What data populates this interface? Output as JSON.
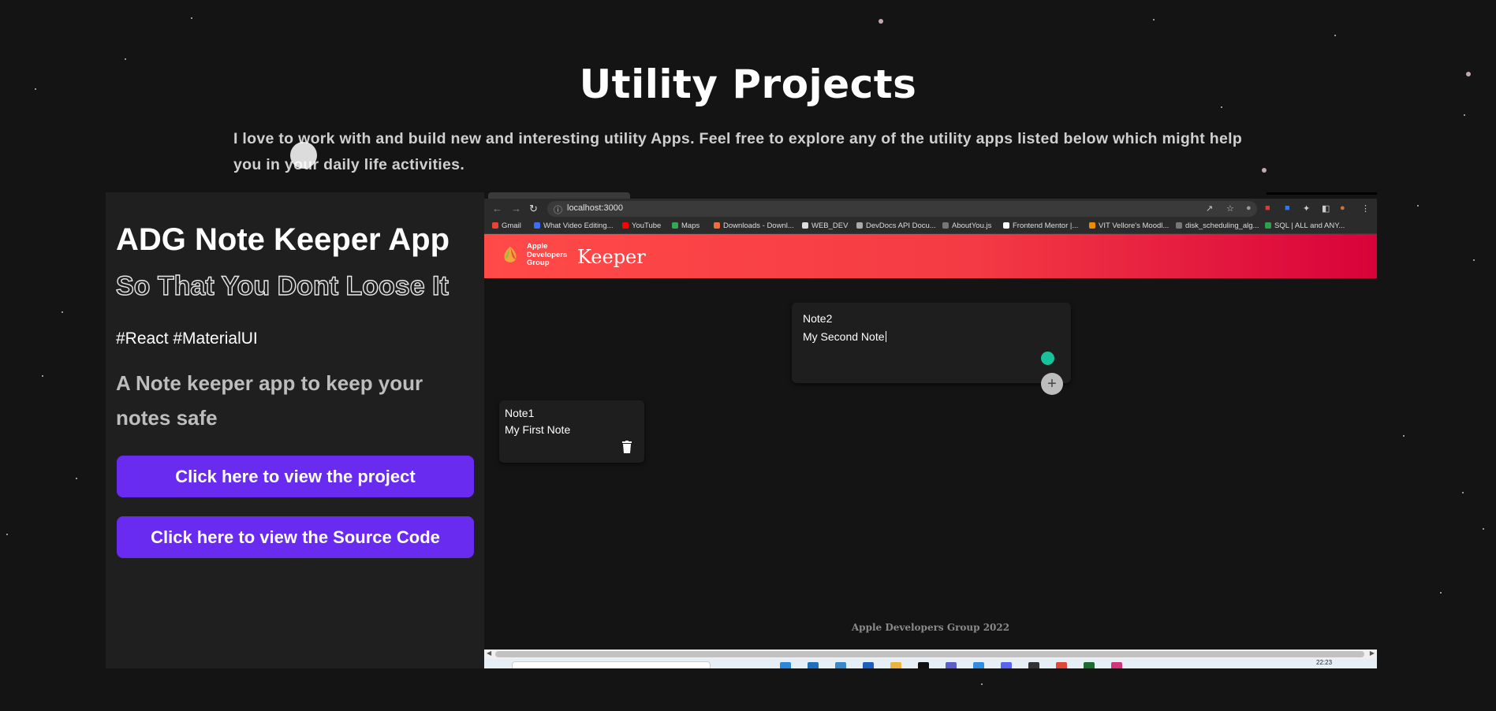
{
  "section": {
    "title": "Utility Projects",
    "description": "I love to work with and build new and interesting utility Apps. Feel free to explore any of the utility apps listed below which might help you in your daily life activities."
  },
  "project": {
    "title": "ADG Note Keeper App",
    "subtitle": "So That You Dont Loose It",
    "tags": "#React #MaterialUI",
    "description": "A Note keeper app to keep your notes safe",
    "view_project_label": "Click here to view the project",
    "view_source_label": "Click here to view the Source Code"
  },
  "screenshot": {
    "url": "localhost:3000",
    "bookmarks": [
      "Gmail",
      "What Video Editing...",
      "YouTube",
      "Maps",
      "Downloads - Downl...",
      "WEB_DEV",
      "DevDocs API Docu...",
      "AboutYou.js",
      "Frontend Mentor |...",
      "VIT Vellore's Moodl...",
      "disk_scheduling_alg...",
      "SQL | ALL and ANY..."
    ],
    "app": {
      "org_line1": "Apple",
      "org_line2": "Developers",
      "org_line3": "Group",
      "title": "Keeper",
      "create_note": {
        "title": "Note2",
        "content": "My Second Note"
      },
      "notes": [
        {
          "title": "Note1",
          "content": "My First Note"
        }
      ],
      "footer": "Apple Developers Group 2022"
    },
    "taskbar_time": "22:23"
  },
  "colors": {
    "page_background": "#141414",
    "card_background": "#1f1f1f",
    "button": "#6a2bf1",
    "header_gradient_start": "#ff4a48",
    "header_gradient_end": "#d8023a"
  }
}
